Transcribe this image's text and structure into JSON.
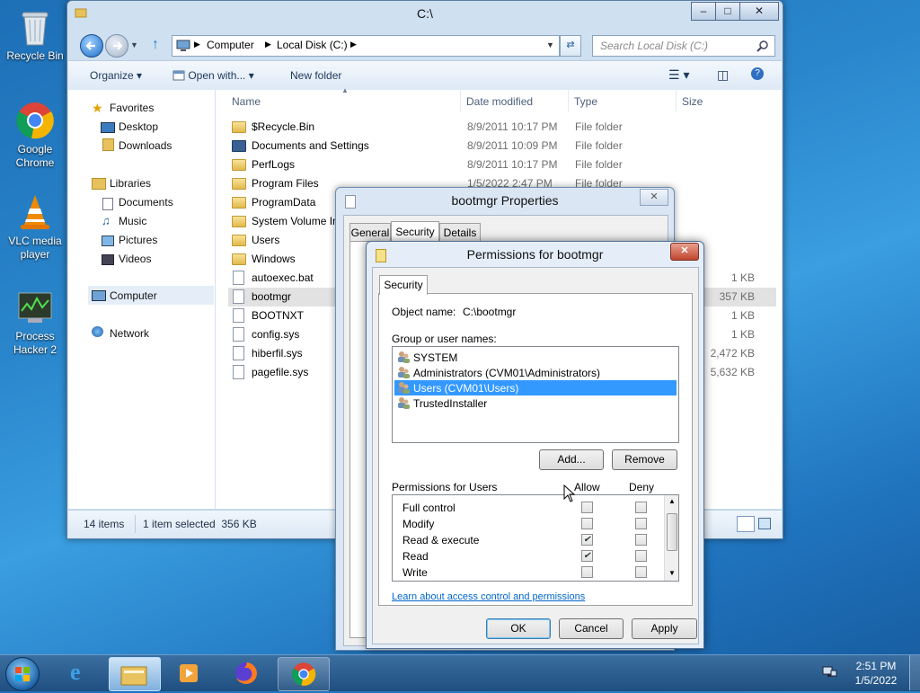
{
  "desktop": {
    "icons": [
      {
        "label": "Recycle Bin"
      },
      {
        "label": "Google Chrome"
      },
      {
        "label": "VLC media player"
      },
      {
        "label": "Process Hacker 2"
      }
    ]
  },
  "explorer": {
    "title": "C:\\",
    "address": {
      "crumbs": [
        "Computer",
        "Local Disk (C:)"
      ]
    },
    "search_placeholder": "Search Local Disk (C:)",
    "commands": {
      "organize": "Organize",
      "open_with": "Open with...",
      "new_folder": "New folder"
    },
    "nav": {
      "favorites": "Favorites",
      "desktop": "Desktop",
      "downloads": "Downloads",
      "libraries": "Libraries",
      "documents": "Documents",
      "music": "Music",
      "pictures": "Pictures",
      "videos": "Videos",
      "computer": "Computer",
      "network": "Network"
    },
    "columns": {
      "name": "Name",
      "date": "Date modified",
      "type": "Type",
      "size": "Size"
    },
    "files": [
      {
        "name": "$Recycle.Bin",
        "date": "8/9/2011 10:17 PM",
        "type": "File folder",
        "size": ""
      },
      {
        "name": "Documents and Settings",
        "date": "8/9/2011 10:09 PM",
        "type": "File folder",
        "size": ""
      },
      {
        "name": "PerfLogs",
        "date": "8/9/2011 10:17 PM",
        "type": "File folder",
        "size": ""
      },
      {
        "name": "Program Files",
        "date": "1/5/2022 2:47 PM",
        "type": "File folder",
        "size": ""
      },
      {
        "name": "ProgramData",
        "date": "",
        "type": "",
        "size": ""
      },
      {
        "name": "System Volume In",
        "date": "",
        "type": "",
        "size": ""
      },
      {
        "name": "Users",
        "date": "",
        "type": "",
        "size": ""
      },
      {
        "name": "Windows",
        "date": "",
        "type": "",
        "size": ""
      },
      {
        "name": "autoexec.bat",
        "date": "",
        "type": "",
        "size": "1 KB"
      },
      {
        "name": "bootmgr",
        "date": "",
        "type": "",
        "size": "357 KB"
      },
      {
        "name": "BOOTNXT",
        "date": "",
        "type": "",
        "size": "1 KB"
      },
      {
        "name": "config.sys",
        "date": "",
        "type": "",
        "size": "1 KB"
      },
      {
        "name": "hiberfil.sys",
        "date": "",
        "type": "",
        "size": "2,472 KB"
      },
      {
        "name": "pagefile.sys",
        "date": "",
        "type": "",
        "size": "5,632 KB"
      }
    ],
    "status": {
      "items": "14 items",
      "selected": "1 item selected  356 KB"
    }
  },
  "properties": {
    "title": "bootmgr Properties",
    "tabs": [
      "General",
      "Security",
      "Details"
    ]
  },
  "permissions": {
    "title": "Permissions for bootmgr",
    "tab": "Security",
    "object_label": "Object name:",
    "object_value": "C:\\bootmgr",
    "group_label": "Group or user names:",
    "users": [
      {
        "name": "SYSTEM",
        "selected": false
      },
      {
        "name": "Administrators (CVM01\\Administrators)",
        "selected": false
      },
      {
        "name": "Users (CVM01\\Users)",
        "selected": true
      },
      {
        "name": "TrustedInstaller",
        "selected": false
      }
    ],
    "add_label": "Add...",
    "remove_label": "Remove",
    "perm_header": "Permissions for Users",
    "allow_label": "Allow",
    "deny_label": "Deny",
    "perms": [
      {
        "name": "Full control",
        "allow": false,
        "deny": false
      },
      {
        "name": "Modify",
        "allow": false,
        "deny": false
      },
      {
        "name": "Read & execute",
        "allow": true,
        "deny": false
      },
      {
        "name": "Read",
        "allow": true,
        "deny": false
      },
      {
        "name": "Write",
        "allow": false,
        "deny": false
      }
    ],
    "learn_link": "Learn about access control and permissions",
    "ok": "OK",
    "cancel": "Cancel",
    "apply": "Apply"
  },
  "taskbar": {
    "time": "2:51 PM",
    "date": "1/5/2022"
  }
}
